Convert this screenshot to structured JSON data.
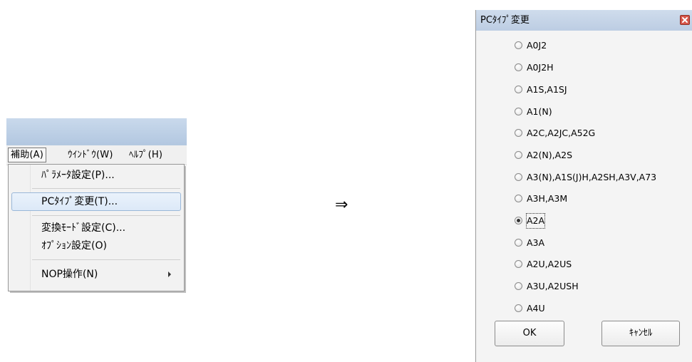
{
  "menu": {
    "menubar": {
      "items": [
        "補助(A)",
        "ｳｲﾝﾄﾞｳ(W)",
        "ﾍﾙﾌﾟ(H)"
      ]
    },
    "dropdown": {
      "items": [
        {
          "label": "ﾊﾟﾗﾒｰﾀ設定(P)..."
        },
        {
          "label": "PCﾀｲﾌﾟ変更(T)..."
        },
        {
          "label": "変換ﾓｰﾄﾞ設定(C)..."
        },
        {
          "label": "ｵﾌﾟｼｮﾝ設定(O)"
        },
        {
          "label": "NOP操作(N)"
        }
      ],
      "highlighted_item": "PCﾀｲﾌﾟ変更(T)..."
    }
  },
  "flow_arrow": "⇒",
  "dialog": {
    "title": "PCﾀｲﾌﾟ変更",
    "options": [
      "A0J2",
      "A0J2H",
      "A1S,A1SJ",
      "A1(N)",
      "A2C,A2JC,A52G",
      "A2(N),A2S",
      "A3(N),A1S(J)H,A2SH,A3V,A73",
      "A3H,A3M",
      "A2A",
      "A3A",
      "A2U,A2US",
      "A3U,A2USH",
      "A4U"
    ],
    "selected_option": "A2A",
    "buttons": {
      "ok": "OK",
      "cancel": "ｷｬﾝｾﾙ"
    }
  },
  "colors": {
    "titlebar": "#bccde3",
    "menu_highlight": "#dce9f8",
    "close_button": "#d7564a"
  }
}
